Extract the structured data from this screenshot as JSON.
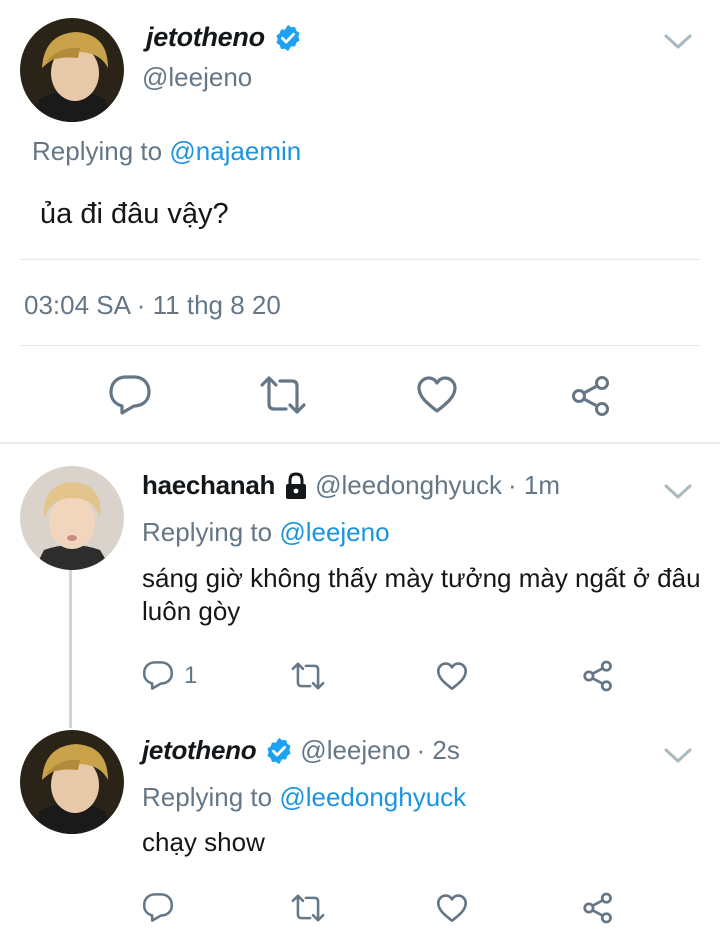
{
  "main_tweet": {
    "display_name": "jetotheno",
    "handle": "@leejeno",
    "verified": true,
    "replying_prefix": "Replying to",
    "replying_to": "@najaemin",
    "text": "ủa đi đâu vậy?",
    "timestamp": "03:04 SA · 11 thg 8 20",
    "actions": [
      "reply-icon",
      "retweet-icon",
      "like-icon",
      "share-icon"
    ]
  },
  "replies": [
    {
      "display_name": "haechanah",
      "locked": true,
      "handle": "@leedonghyuck",
      "time": "· 1m",
      "replying_prefix": "Replying to",
      "replying_to": "@leejeno",
      "text": "sáng giờ không thấy mày tưởng mày ngất ở đâu luôn gòy",
      "reply_count": "1"
    },
    {
      "display_name": "jetotheno",
      "verified": true,
      "handle": "@leejeno",
      "time": "· 2s",
      "replying_prefix": "Replying to",
      "replying_to": "@leedonghyuck",
      "text": "chạy show"
    }
  ],
  "colors": {
    "link": "#1b95e0",
    "secondary_text": "#657786",
    "icon": "#657786",
    "divider": "#e1e8ed"
  }
}
